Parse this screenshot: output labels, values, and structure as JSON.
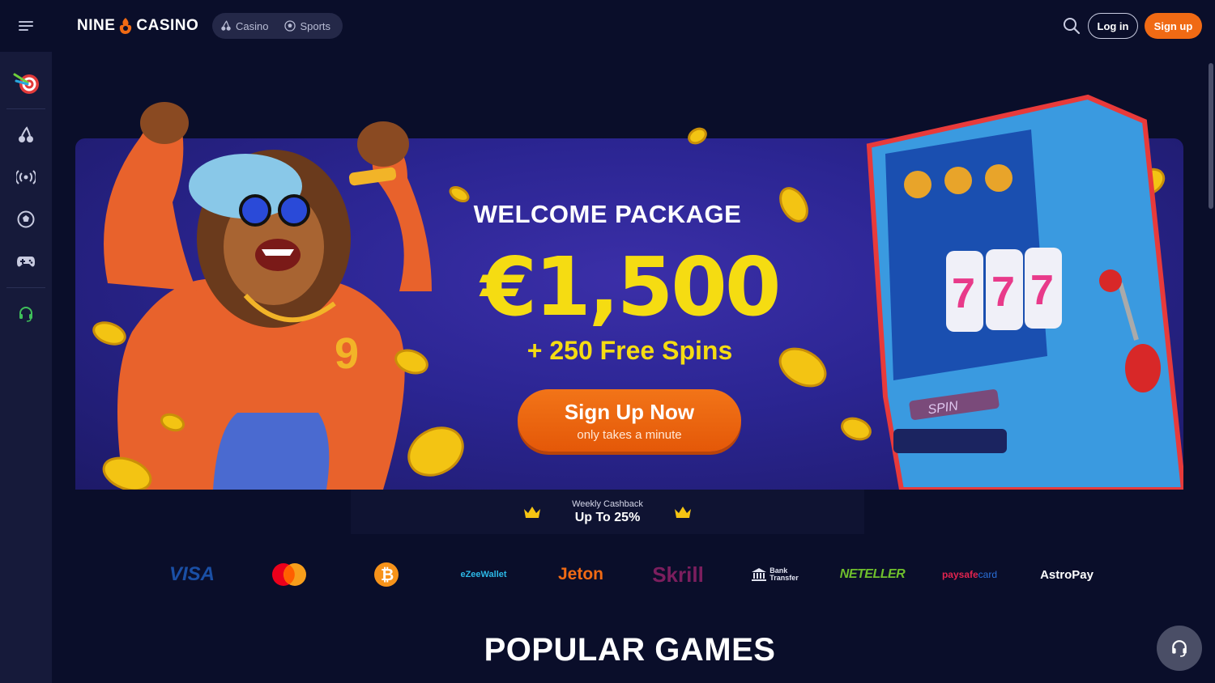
{
  "header": {
    "logo_left": "NINE",
    "logo_right": "CASINO",
    "nav": [
      {
        "label": "Casino",
        "icon": "cherry-icon"
      },
      {
        "label": "Sports",
        "icon": "football-icon"
      }
    ],
    "login_label": "Log in",
    "signup_label": "Sign up"
  },
  "sidebar": {
    "items": [
      {
        "name": "dart-target-icon"
      },
      {
        "name": "casino-cherry-icon"
      },
      {
        "name": "live-broadcast-icon"
      },
      {
        "name": "sports-football-icon"
      },
      {
        "name": "gamepad-icon"
      },
      {
        "name": "support-headset-icon"
      }
    ]
  },
  "banner": {
    "title": "WELCOME PACKAGE",
    "amount": "€1,500",
    "spins": "+ 250 Free Spins",
    "cta_main": "Sign Up Now",
    "cta_sub": "only takes a minute"
  },
  "cashback": {
    "label": "Weekly Cashback",
    "value": "Up To 25%"
  },
  "payments": [
    "VISA",
    "Mastercard",
    "Bitcoin",
    "eZeeWallet",
    "Jeton",
    "Skrill",
    "Bank Transfer",
    "NETELLER",
    "paysafecard",
    "AstroPay"
  ],
  "payment_text": {
    "visa": "VISA",
    "ezee": "eZeeWallet",
    "jeton": "Jeton",
    "skrill": "Skrill",
    "bank_1": "Bank",
    "bank_2": "Transfer",
    "neteller": "NETELLER",
    "paysafe_a": "paysafe",
    "paysafe_b": "card",
    "astro": "AstroPay"
  },
  "popular_title": "POPULAR GAMES",
  "colors": {
    "background": "#0a0e2a",
    "sidebar": "#161a3a",
    "accent_orange": "#f06a14",
    "gold": "#f5dc12",
    "banner_purple": "#2b2592"
  }
}
